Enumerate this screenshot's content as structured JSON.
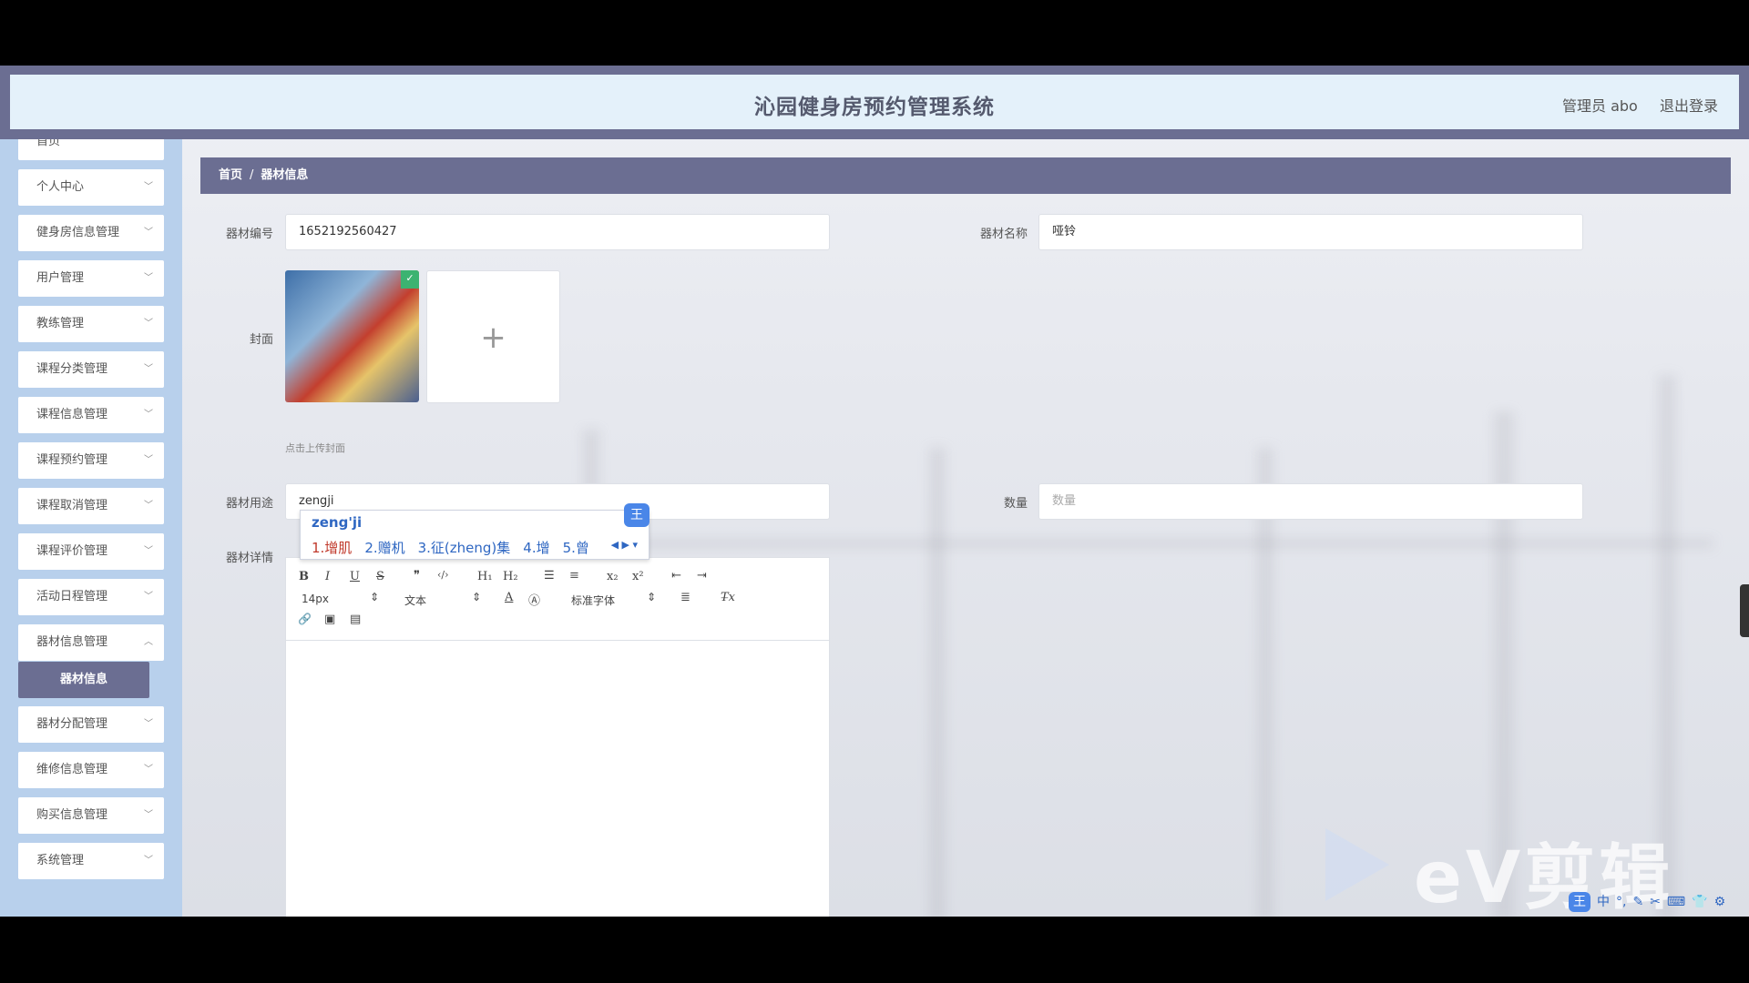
{
  "header": {
    "title": "沁园健身房预约管理系统",
    "admin": "管理员 abo",
    "logout": "退出登录"
  },
  "sidebar": {
    "items": [
      {
        "label": "首页"
      },
      {
        "label": "个人中心"
      },
      {
        "label": "健身房信息管理"
      },
      {
        "label": "用户管理"
      },
      {
        "label": "教练管理"
      },
      {
        "label": "课程分类管理"
      },
      {
        "label": "课程信息管理"
      },
      {
        "label": "课程预约管理"
      },
      {
        "label": "课程取消管理"
      },
      {
        "label": "课程评价管理"
      },
      {
        "label": "活动日程管理"
      },
      {
        "label": "器材信息管理"
      },
      {
        "label": "器材分配管理"
      },
      {
        "label": "维修信息管理"
      },
      {
        "label": "购买信息管理"
      },
      {
        "label": "系统管理"
      }
    ],
    "active_sub": "器材信息"
  },
  "breadcrumb": {
    "home": "首页",
    "sep": "/",
    "current": "器材信息"
  },
  "form": {
    "code_label": "器材编号",
    "code_value": "1652192560427",
    "name_label": "器材名称",
    "name_value": "哑铃",
    "cover_label": "封面",
    "upload_hint": "点击上传封面",
    "upload_plus": "+",
    "usage_label": "器材用途",
    "usage_value": "zengji",
    "qty_label": "数量",
    "qty_placeholder": "数量",
    "detail_label": "器材详情"
  },
  "ime": {
    "pinyin": "zeng'ji",
    "logo": "王",
    "candidates": [
      "1.增肌",
      "2.赠机",
      "3.征(zheng)集",
      "4.增",
      "5.曾"
    ],
    "nav": "◀ ▶ ▾"
  },
  "editor": {
    "font_size": "14px",
    "block_type": "文本",
    "font_family": "标准字体",
    "buttons": [
      "B",
      "I",
      "U",
      "S",
      "❞",
      "‹/›",
      "H₁",
      "H₂",
      "☰",
      "≡",
      "x₂",
      "x²",
      "⇤",
      "⇥",
      "A",
      "Ⓐ",
      "≣",
      "T̶x",
      "🔗",
      "▣",
      "▤"
    ]
  },
  "watermark": "eV剪辑",
  "imebar": {
    "logo": "王",
    "items": [
      "中",
      "°,",
      "✎",
      "✂",
      "⌨",
      "👕",
      "⚙"
    ]
  }
}
